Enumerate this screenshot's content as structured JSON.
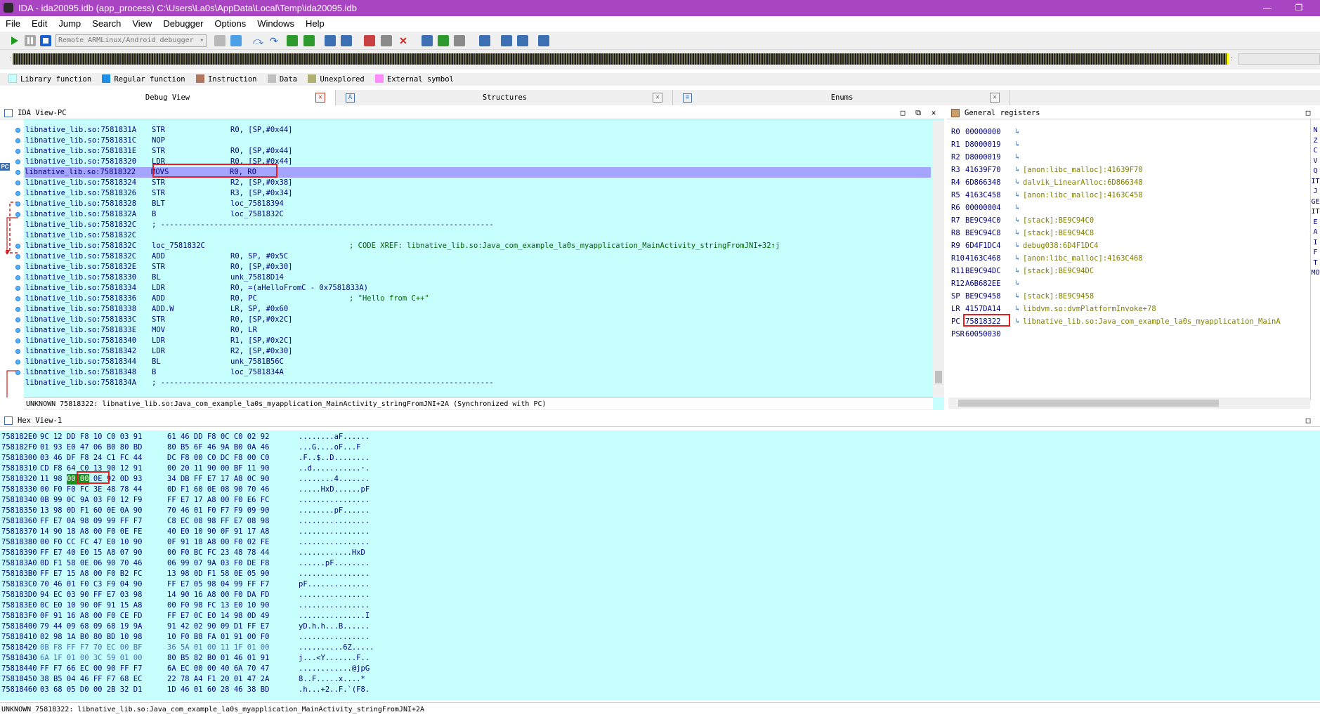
{
  "window": {
    "title": "IDA - ida20095.idb (app_process) C:\\Users\\La0s\\AppData\\Local\\Temp\\ida20095.idb"
  },
  "menu": [
    "File",
    "Edit",
    "Jump",
    "Search",
    "View",
    "Debugger",
    "Options",
    "Windows",
    "Help"
  ],
  "toolbar": {
    "debugger_select": "Remote ARMLinux/Android debugger"
  },
  "legend": [
    {
      "label": "Library function",
      "color": "#c7ffff"
    },
    {
      "label": "Regular function",
      "color": "#1e8fe6"
    },
    {
      "label": "Instruction",
      "color": "#b07860"
    },
    {
      "label": "Data",
      "color": "#c0c0c0"
    },
    {
      "label": "Unexplored",
      "color": "#b0b070"
    },
    {
      "label": "External symbol",
      "color": "#ff8cff"
    }
  ],
  "tabs": {
    "debug_view": "Debug View",
    "structures": "Structures",
    "enums": "Enums"
  },
  "ida_view": {
    "title": "IDA View-PC",
    "pc_label": "PC",
    "lines": [
      {
        "addr": "libnative_lib.so:7581831A",
        "mnem": "STR",
        "ops": "R0, [SP,#0x44]"
      },
      {
        "addr": "libnative_lib.so:7581831C",
        "mnem": "NOP",
        "ops": ""
      },
      {
        "addr": "libnative_lib.so:7581831E",
        "mnem": "STR",
        "ops": "R0, [SP,#0x44]"
      },
      {
        "addr": "libnative_lib.so:75818320",
        "mnem": "LDR",
        "ops": "R0, [SP,#0x44]"
      },
      {
        "addr": "libnative_lib.so:75818322",
        "mnem": "MOVS",
        "ops": "R0, R0"
      },
      {
        "addr": "libnative_lib.so:75818324",
        "mnem": "STR",
        "ops": "R2, [SP,#0x38]"
      },
      {
        "addr": "libnative_lib.so:75818326",
        "mnem": "STR",
        "ops": "R3, [SP,#0x34]"
      },
      {
        "addr": "libnative_lib.so:75818328",
        "mnem": "BLT",
        "ops": "loc_75818394"
      },
      {
        "addr": "libnative_lib.so:7581832A",
        "mnem": "B",
        "ops": "loc_7581832C"
      },
      {
        "addr": "libnative_lib.so:7581832C",
        "mnem": "; ---------------------------------------------------------------------------",
        "ops": ""
      },
      {
        "addr": "libnative_lib.so:7581832C",
        "mnem": "",
        "ops": ""
      },
      {
        "addr": "libnative_lib.so:7581832C",
        "mnem": "loc_7581832C",
        "ops": "",
        "comment": "; CODE XREF: libnative_lib.so:Java_com_example_la0s_myapplication_MainActivity_stringFromJNI+32↑j"
      },
      {
        "addr": "libnative_lib.so:7581832C",
        "mnem": "ADD",
        "ops": "R0, SP, #0x5C"
      },
      {
        "addr": "libnative_lib.so:7581832E",
        "mnem": "STR",
        "ops": "R0, [SP,#0x30]"
      },
      {
        "addr": "libnative_lib.so:75818330",
        "mnem": "BL",
        "ops": "unk_75818D14"
      },
      {
        "addr": "libnative_lib.so:75818334",
        "mnem": "LDR",
        "ops": "R0, =(aHelloFromC - 0x7581833A)"
      },
      {
        "addr": "libnative_lib.so:75818336",
        "mnem": "ADD",
        "ops": "R0, PC",
        "comment": "; \"Hello from C++\""
      },
      {
        "addr": "libnative_lib.so:75818338",
        "mnem": "ADD.W",
        "ops": "LR, SP, #0x60"
      },
      {
        "addr": "libnative_lib.so:7581833C",
        "mnem": "STR",
        "ops": "R0, [SP,#0x2C]"
      },
      {
        "addr": "libnative_lib.so:7581833E",
        "mnem": "MOV",
        "ops": "R0, LR"
      },
      {
        "addr": "libnative_lib.so:75818340",
        "mnem": "LDR",
        "ops": "R1, [SP,#0x2C]"
      },
      {
        "addr": "libnative_lib.so:75818342",
        "mnem": "LDR",
        "ops": "R2, [SP,#0x30]"
      },
      {
        "addr": "libnative_lib.so:75818344",
        "mnem": "BL",
        "ops": "unk_7581B56C"
      },
      {
        "addr": "libnative_lib.so:75818348",
        "mnem": "B",
        "ops": "loc_7581834A"
      },
      {
        "addr": "libnative_lib.so:7581834A",
        "mnem": "; ---------------------------------------------------------------------------",
        "ops": ""
      }
    ],
    "status": "UNKNOWN 75818322: libnative_lib.so:Java_com_example_la0s_myapplication_MainActivity_stringFromJNI+2A (Synchronized with PC)"
  },
  "registers": {
    "title": "General registers",
    "rows": [
      {
        "name": "R0",
        "value": "00000000",
        "comment": ""
      },
      {
        "name": "R1",
        "value": "D8000019",
        "comment": ""
      },
      {
        "name": "R2",
        "value": "D8000019",
        "comment": ""
      },
      {
        "name": "R3",
        "value": "41639F70",
        "comment": "[anon:libc_malloc]:41639F70"
      },
      {
        "name": "R4",
        "value": "6D866348",
        "comment": "dalvik_LinearAlloc:6D866348"
      },
      {
        "name": "R5",
        "value": "4163C458",
        "comment": "[anon:libc_malloc]:4163C458"
      },
      {
        "name": "R6",
        "value": "00000004",
        "comment": ""
      },
      {
        "name": "R7",
        "value": "BE9C94C0",
        "comment": "[stack]:BE9C94C0"
      },
      {
        "name": "R8",
        "value": "BE9C94C8",
        "comment": "[stack]:BE9C94C8"
      },
      {
        "name": "R9",
        "value": "6D4F1DC4",
        "comment": "debug038:6D4F1DC4"
      },
      {
        "name": "R10",
        "value": "4163C468",
        "comment": "[anon:libc_malloc]:4163C468"
      },
      {
        "name": "R11",
        "value": "BE9C94DC",
        "comment": "[stack]:BE9C94DC"
      },
      {
        "name": "R12",
        "value": "A6B682EE",
        "comment": ""
      },
      {
        "name": "SP",
        "value": "BE9C9458",
        "comment": "[stack]:BE9C9458"
      },
      {
        "name": "LR",
        "value": "4157DA14",
        "comment": "libdvm.so:dvmPlatformInvoke+78"
      },
      {
        "name": "PC",
        "value": "75818322",
        "comment": "libnative_lib.so:Java_com_example_la0s_myapplication_MainA"
      },
      {
        "name": "PSR",
        "value": "60050030",
        "comment": ""
      }
    ],
    "flags": [
      "N",
      "Z",
      "C",
      "V",
      "Q",
      "IT",
      "J",
      "GE",
      "IT",
      "E",
      "A",
      "I",
      "F",
      "T",
      "MO"
    ]
  },
  "hex_view": {
    "title": "Hex View-1",
    "rows": [
      {
        "addr": "758182E0",
        "b1": "9C 12 DD F8 10 C0 03 91",
        "b2": "61 46 DD F8 0C C0 02 92",
        "ascii": "........aF......"
      },
      {
        "addr": "758182F0",
        "b1": "01 93 E0 47 06 B0 80 BD",
        "b2": "80 B5 6F 46 9A B0 0A 46",
        "ascii": "...G....oF...F"
      },
      {
        "addr": "75818300",
        "b1": "03 46 DF F8 24 C1 FC 44",
        "b2": "DC F8 00 C0 DC F8 00 C0",
        "ascii": ".F..$..D........"
      },
      {
        "addr": "75818310",
        "b1": "CD F8 64 C0 13 90 12 91",
        "b2": "00 20 11 90 00 BF 11 90",
        "ascii": "..d...........·."
      },
      {
        "addr": "75818320",
        "b1": "11 98 00 00 0E 92 0D 93",
        "b2": "34 DB FF E7 17 A8 0C 90",
        "ascii": "........4......."
      },
      {
        "addr": "75818330",
        "b1": "00 F0 F0 FC 3E 48 78 44",
        "b2": "0D F1 60 0E 08 90 70 46",
        "ascii": ".....HxD......pF"
      },
      {
        "addr": "75818340",
        "b1": "0B 99 0C 9A 03 F0 12 F9",
        "b2": "FF E7 17 A8 00 F0 E6 FC",
        "ascii": "................"
      },
      {
        "addr": "75818350",
        "b1": "13 98 0D F1 60 0E 0A 90",
        "b2": "70 46 01 F0 F7 F9 09 90",
        "ascii": "........pF......"
      },
      {
        "addr": "75818360",
        "b1": "FF E7 0A 98 09 99 FF F7",
        "b2": "C8 EC 08 98 FF E7 08 98",
        "ascii": "................"
      },
      {
        "addr": "75818370",
        "b1": "14 90 18 A8 00 F0 0E FE",
        "b2": "40 E0 10 90 0F 91 17 A8",
        "ascii": "................"
      },
      {
        "addr": "75818380",
        "b1": "00 F0 CC FC 47 E0 10 90",
        "b2": "0F 91 18 A8 00 F0 02 FE",
        "ascii": "................"
      },
      {
        "addr": "75818390",
        "b1": "FF E7 40 E0 15 A8 07 90",
        "b2": "00 F0 BC FC 23 48 78 44",
        "ascii": "............HxD"
      },
      {
        "addr": "758183A0",
        "b1": "0D F1 58 0E 06 90 70 46",
        "b2": "06 99 07 9A 03 F0 DE F8",
        "ascii": "......pF........"
      },
      {
        "addr": "758183B0",
        "b1": "FF E7 15 A8 00 F0 B2 FC",
        "b2": "13 98 0D F1 58 0E 05 90",
        "ascii": "................"
      },
      {
        "addr": "758183C0",
        "b1": "70 46 01 F0 C3 F9 04 90",
        "b2": "FF E7 05 98 04 99 FF F7",
        "ascii": "pF.............."
      },
      {
        "addr": "758183D0",
        "b1": "94 EC 03 90 FF E7 03 98",
        "b2": "14 90 16 A8 00 F0 DA FD",
        "ascii": "................"
      },
      {
        "addr": "758183E0",
        "b1": "0C E0 10 90 0F 91 15 A8",
        "b2": "00 F0 98 FC 13 E0 10 90",
        "ascii": "................"
      },
      {
        "addr": "758183F0",
        "b1": "0F 91 16 A8 00 F0 CE FD",
        "b2": "FF E7 0C E0 14 98 0D 49",
        "ascii": "...............I"
      },
      {
        "addr": "75818400",
        "b1": "79 44 09 68 09 68 19 9A",
        "b2": "91 42 02 90 09 D1 FF E7",
        "ascii": "yD.h.h...B......"
      },
      {
        "addr": "75818410",
        "b1": "02 98 1A B0 80 BD 10 98",
        "b2": "10 F0 B8 FA 01 91 00 F0",
        "ascii": "................"
      },
      {
        "addr": "75818420",
        "b1": "0B F8 FF F7 70 EC 00 BF",
        "b2": "36 5A 01 00 11 1F 01 00",
        "ascii": "..........6Z....."
      },
      {
        "addr": "75818430",
        "b1": "6A 1F 01 00 3C 59 01 00",
        "b2": "80 B5 82 B0 01 46 01 91",
        "ascii": "j...<Y.......F.."
      },
      {
        "addr": "75818440",
        "b1": "FF F7 66 EC 00 90 FF F7",
        "b2": "6A EC 00 00 40 6A 70 47",
        "ascii": "............@jpG"
      },
      {
        "addr": "75818450",
        "b1": "38 B5 04 46 FF F7 68 EC",
        "b2": "22 78 A4 F1 20 01 47 2A",
        "ascii": "8..F.....x....*"
      },
      {
        "addr": "75818460",
        "b1": "03 68 05 D0 00 2B 32 D1",
        "b2": "1D 46 01 60 28 46 38 BD",
        "ascii": ".h...+2..F.`(F8."
      }
    ],
    "status": "UNKNOWN 75818322: libnative_lib.so:Java_com_example_la0s_myapplication_MainActivity_stringFromJNI+2A"
  }
}
